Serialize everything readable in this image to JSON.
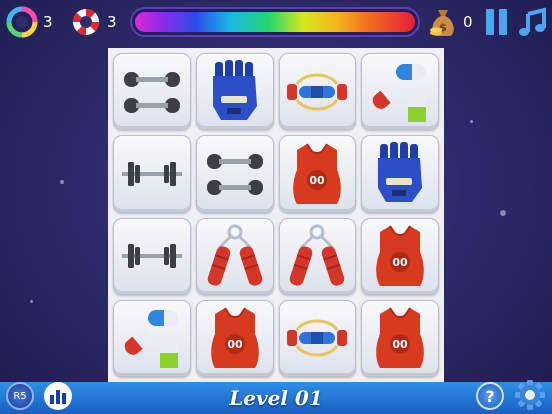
{
  "hud": {
    "shuffle_count": "3",
    "lifebuoy_count": "3",
    "coins_count": "0"
  },
  "board": {
    "rows": 4,
    "cols": 4,
    "tiles": [
      "dumbbell-pair",
      "glove",
      "expander",
      "pills",
      "barbell",
      "dumbbell-pair",
      "jersey",
      "glove",
      "barbell",
      "hand-gripper",
      "hand-gripper",
      "jersey",
      "pills",
      "jersey",
      "expander",
      "jersey"
    ],
    "jersey_number": "00"
  },
  "footer": {
    "level_label": "Level 01",
    "rank_badge": "R5",
    "help_label": "?"
  },
  "colors": {
    "accent_blue": "#2f8fe6",
    "jersey_red": "#d73a1f",
    "glove_blue": "#1f3fa8"
  }
}
